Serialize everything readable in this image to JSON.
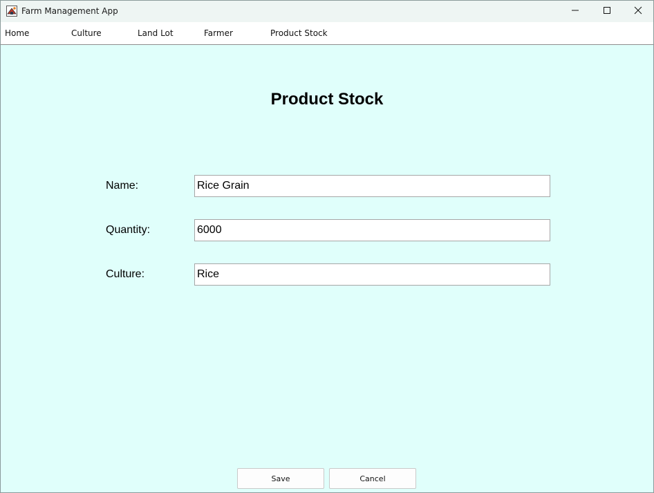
{
  "window": {
    "title": "Farm Management App",
    "controls": {
      "minimize": "minimize-icon",
      "maximize": "maximize-icon",
      "close": "close-icon"
    }
  },
  "menu": {
    "items": [
      {
        "label": "Home"
      },
      {
        "label": "Culture"
      },
      {
        "label": "Land Lot"
      },
      {
        "label": "Farmer"
      },
      {
        "label": "Product Stock"
      }
    ]
  },
  "form": {
    "title": "Product Stock",
    "fields": [
      {
        "label": "Name:",
        "value": "Rice Grain"
      },
      {
        "label": "Quantity:",
        "value": "6000"
      },
      {
        "label": "Culture:",
        "value": "Rice"
      }
    ]
  },
  "buttons": {
    "save": "Save",
    "cancel": "Cancel"
  },
  "colors": {
    "background": "#e0fffb",
    "titlebar": "#eef5f3",
    "menubar": "#ffffff"
  }
}
